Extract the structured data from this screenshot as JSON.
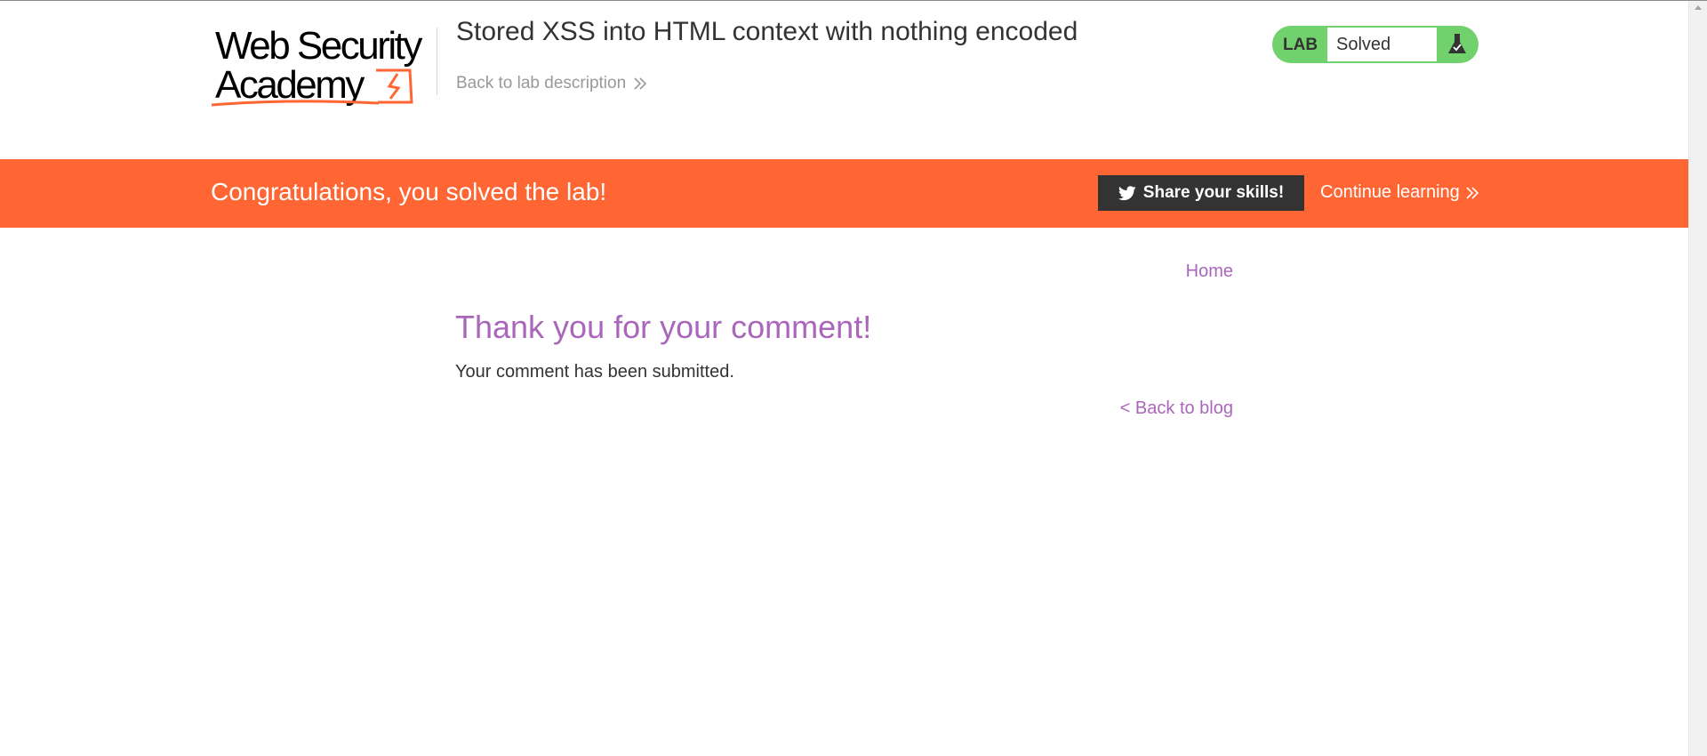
{
  "header": {
    "logo": {
      "line1": "Web Security",
      "line2": "Academy"
    },
    "lab_title": "Stored XSS into HTML context with nothing encoded",
    "back_to_description": "Back to lab description"
  },
  "lab_status": {
    "badge": "LAB",
    "state": "Solved",
    "icon": "flask-icon",
    "color": "#70d16d"
  },
  "banner": {
    "message": "Congratulations, you solved the lab!",
    "share_label": "Share your skills!",
    "share_icon": "twitter-bird-icon",
    "continue_label": "Continue learning",
    "color": "#ff6633"
  },
  "main": {
    "nav_home": "Home",
    "heading": "Thank you for your comment!",
    "message": "Your comment has been submitted.",
    "back_to_blog": "< Back to blog"
  },
  "colors": {
    "accent_purple": "#aa66bb",
    "brand_orange": "#ff6633",
    "text_dark": "#333333"
  }
}
